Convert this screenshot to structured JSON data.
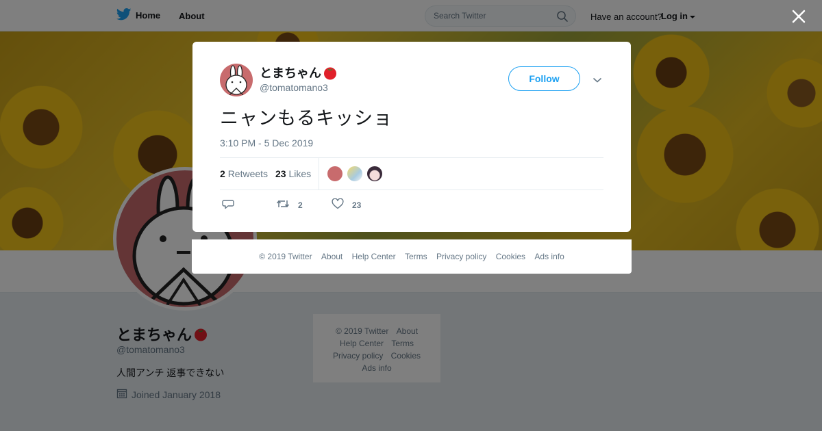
{
  "topbar": {
    "home_label": "Home",
    "about_label": "About",
    "search_placeholder": "Search Twitter",
    "have_account": "Have an account?",
    "login_label": "Log in"
  },
  "profile": {
    "name": "とまちゃん",
    "handle": "@tomatomano3",
    "bio": "人間アンチ 返事できない",
    "joined": "Joined January 2018"
  },
  "side_footer": {
    "copyright": "© 2019 Twitter",
    "about": "About",
    "help": "Help Center",
    "terms": "Terms",
    "privacy": "Privacy policy",
    "cookies": "Cookies",
    "ads": "Ads info"
  },
  "tweet": {
    "author_name": "とまちゃん",
    "author_handle": "@tomatomano3",
    "follow_label": "Follow",
    "text": "ニャンもるキッショ",
    "timestamp": "3:10 PM - 5 Dec 2019",
    "retweets_count": "2",
    "retweets_label": "Retweets",
    "likes_count": "23",
    "likes_label": "Likes",
    "action_retweet_count": "2",
    "action_like_count": "23"
  },
  "modal_footer": {
    "copyright": "© 2019 Twitter",
    "about": "About",
    "help": "Help Center",
    "terms": "Terms",
    "privacy": "Privacy policy",
    "cookies": "Cookies",
    "ads": "Ads info"
  },
  "icons": {
    "logo": "twitter-bird-icon",
    "search": "search-icon",
    "close": "close-icon",
    "reply": "reply-icon",
    "retweet": "retweet-icon",
    "like": "heart-icon",
    "calendar": "calendar-icon",
    "emoji": "tomato-emoji"
  },
  "colors": {
    "accent": "#1da1f2",
    "avatar_bg": "#c86b6d",
    "tomato": "#e0202a"
  }
}
